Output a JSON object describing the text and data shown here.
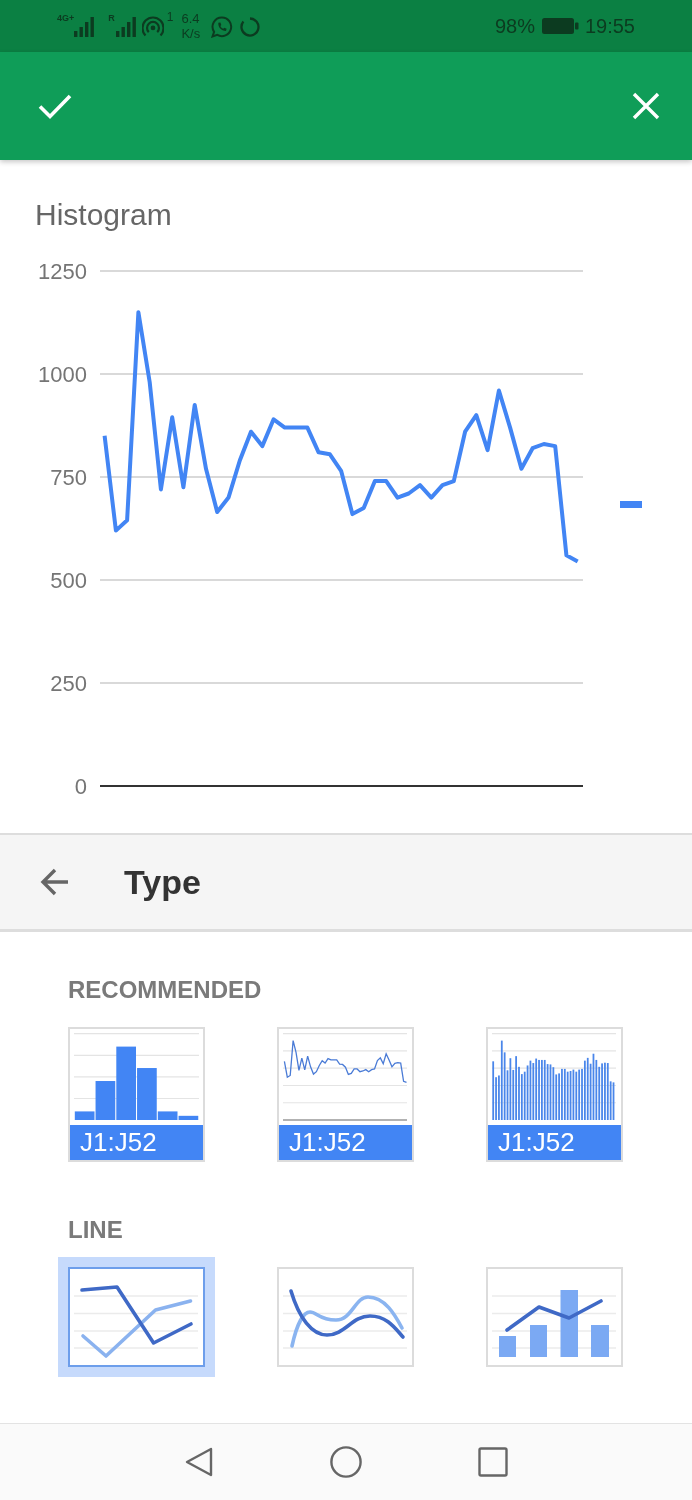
{
  "status_bar": {
    "network_type": "4G+",
    "roaming": "R",
    "hotspot_count": "1",
    "speed": "6.4",
    "speed_unit": "K/s",
    "battery": "98%",
    "time": "19:55"
  },
  "chart": {
    "chart_data": {
      "type": "line",
      "title": "Histogram",
      "grid": true,
      "ylim": [
        0,
        1250
      ],
      "yticks": [
        0,
        250,
        500,
        750,
        1000,
        1250
      ],
      "series": [
        {
          "color": "#4285f4",
          "values": [
            850,
            620,
            645,
            1150,
            980,
            720,
            895,
            725,
            925,
            770,
            665,
            700,
            790,
            860,
            825,
            890,
            870,
            870,
            870,
            810,
            805,
            765,
            660,
            675,
            740,
            740,
            700,
            710,
            730,
            700,
            730,
            740,
            860,
            900,
            815,
            960,
            870,
            770,
            820,
            830,
            825,
            560,
            545
          ]
        }
      ]
    }
  },
  "panel": {
    "title": "Type"
  },
  "sections": [
    {
      "label": "RECOMMENDED",
      "options": [
        {
          "kind": "histogram",
          "label": "J1:J52",
          "selected": false
        },
        {
          "kind": "line",
          "label": "J1:J52",
          "selected": false
        },
        {
          "kind": "column",
          "label": "J1:J52",
          "selected": false
        }
      ]
    },
    {
      "label": "LINE",
      "options": [
        {
          "kind": "line",
          "selected": true
        },
        {
          "kind": "smooth_line",
          "selected": false
        },
        {
          "kind": "combo",
          "selected": false
        }
      ]
    }
  ]
}
